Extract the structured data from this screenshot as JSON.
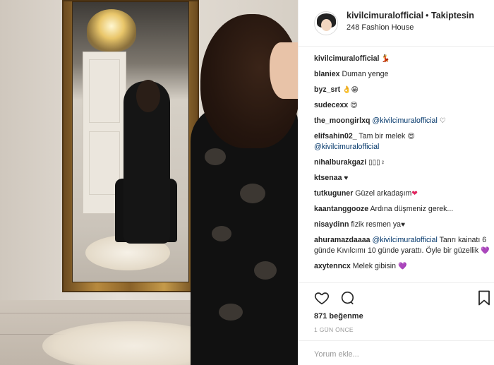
{
  "header": {
    "username": "kivilcimuralofficial",
    "separator": "•",
    "follow_status": "Takiptesin",
    "location": "248 Fashion House"
  },
  "comments": [
    {
      "user": "kivilcimuralofficial",
      "text": "",
      "emoji": "💃"
    },
    {
      "user": "blaniex",
      "text": "Duman yenge",
      "emoji": ""
    },
    {
      "user": "byz_srt",
      "text": "",
      "emoji": "👌😁"
    },
    {
      "user": "sudecexx",
      "text": "",
      "emoji": "😍"
    },
    {
      "user": "the_moongirlxq",
      "text": "",
      "mention": "@kivilcimuralofficial",
      "emoji": "♡"
    },
    {
      "user": "elifsahin02_",
      "text": "Tam bir melek",
      "emoji": "😍",
      "mention": "@kivilcimuralofficial"
    },
    {
      "user": "nihalburakgazi",
      "text": "",
      "emoji": "▯▯▯♀"
    },
    {
      "user": "ktsenaa",
      "text": "",
      "emoji": "♥"
    },
    {
      "user": "tutkuguner",
      "text": "Güzel arkadaşım",
      "emoji": "❤"
    },
    {
      "user": "kaantanggooze",
      "text": "Ardına düşmeniz gerek...",
      "emoji": ""
    },
    {
      "user": "nisaydinn",
      "text": "fizik resmen ya",
      "emoji": "♥"
    },
    {
      "user": "ahuramazdaaaa",
      "mention": "@kivilcimuralofficial",
      "text": "Tanrı kainatı 6 günde Kıvılcımı 10 günde yarattı. Öyle bir güzellik",
      "emoji": "💜"
    },
    {
      "user": "axytenncx",
      "text": "Melek gibisin",
      "emoji": "💜"
    }
  ],
  "actions": {
    "like_icon": "heart-icon",
    "comment_icon": "comment-icon",
    "save_icon": "bookmark-icon"
  },
  "likes": "871 beğenme",
  "time": "1 GÜN ÖNCE",
  "add_comment": {
    "placeholder": "Yorum ekle..."
  },
  "colors": {
    "mention": "#003569",
    "border": "#efefef",
    "text": "#262626",
    "muted": "#999999"
  }
}
